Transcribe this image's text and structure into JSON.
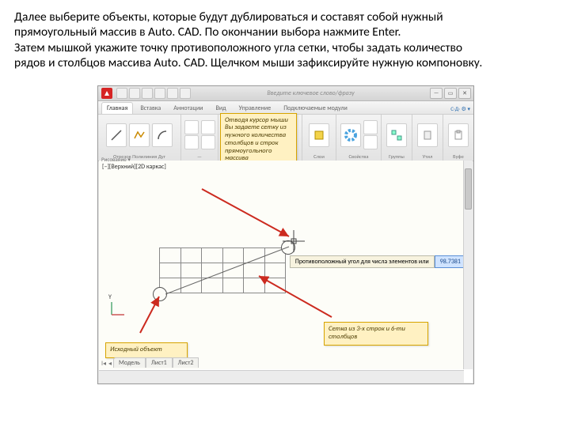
{
  "instruction": {
    "line1": "Далее выберите объекты, которые будут дублироваться и составят собой нужный",
    "line2": "прямоугольный массив в Auto. CAD. По окончании выбора нажмите Enter.",
    "line3": "Затем мышкой укажите точку противоположного угла сетки, чтобы задать количество",
    "line4": "рядов и столбцов массива Auto. CAD. Щелчком мыши зафиксируйте нужную компоновку."
  },
  "titlebar": {
    "title": "Введите ключевое слово/фразу"
  },
  "tabs": [
    "Главная",
    "Вставка",
    "Аннотации",
    "Вид",
    "Управление",
    "Подключаемые модули"
  ],
  "tabs_right": "С·Д· ⚙ ▾",
  "ribbon": {
    "panel1": {
      "l1": "Отрезок",
      "l2": "Полилиния",
      "l3": "Дуг"
    },
    "panel2": "—",
    "panel_draw": "Рисование ▾",
    "panel_layers": "Слои",
    "panel_props": "Свойства",
    "panel_groups": "Группы",
    "panel_util": "Утил",
    "panel_clip": "Буфе"
  },
  "canvas": {
    "view_label": "[–][Верхний][2D каркас]",
    "tooltip_label": "Противоположный угол для числа элементов или",
    "tooltip_value": "98.7381"
  },
  "callouts": {
    "cursor": "Отводя курсор мыши Вы задаете сетку из нужного количества столбцов и строк прямоугольного массива",
    "grid": "Сетка из 3-х строк и 6-ти столбцов",
    "source": "Исходный объект"
  },
  "layout_tabs": [
    "Модель",
    "Лист1",
    "Лист2"
  ]
}
